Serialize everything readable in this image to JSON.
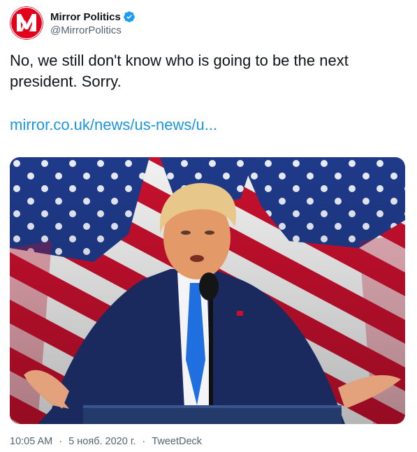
{
  "account": {
    "display_name": "Mirror Politics",
    "handle": "@MirrorPolitics",
    "verified": true,
    "avatar_letter": "M",
    "avatar_color": "#e2001a",
    "verified_color": "#1d9bf0"
  },
  "tweet": {
    "text_line1": "No, we still don't know who is going to be the next",
    "text_line2": "president. Sorry.",
    "link": "mirror.co.uk/news/us-news/u..."
  },
  "media": {
    "icon": "photo-of-speaker-at-podium-with-flags"
  },
  "meta": {
    "time": "10:05 AM",
    "date": "5 нояб. 2020 г.",
    "separator": "·",
    "source": "TweetDeck"
  },
  "colors": {
    "link": "#1b95e0",
    "text": "#0f1419",
    "secondary": "#536471"
  }
}
